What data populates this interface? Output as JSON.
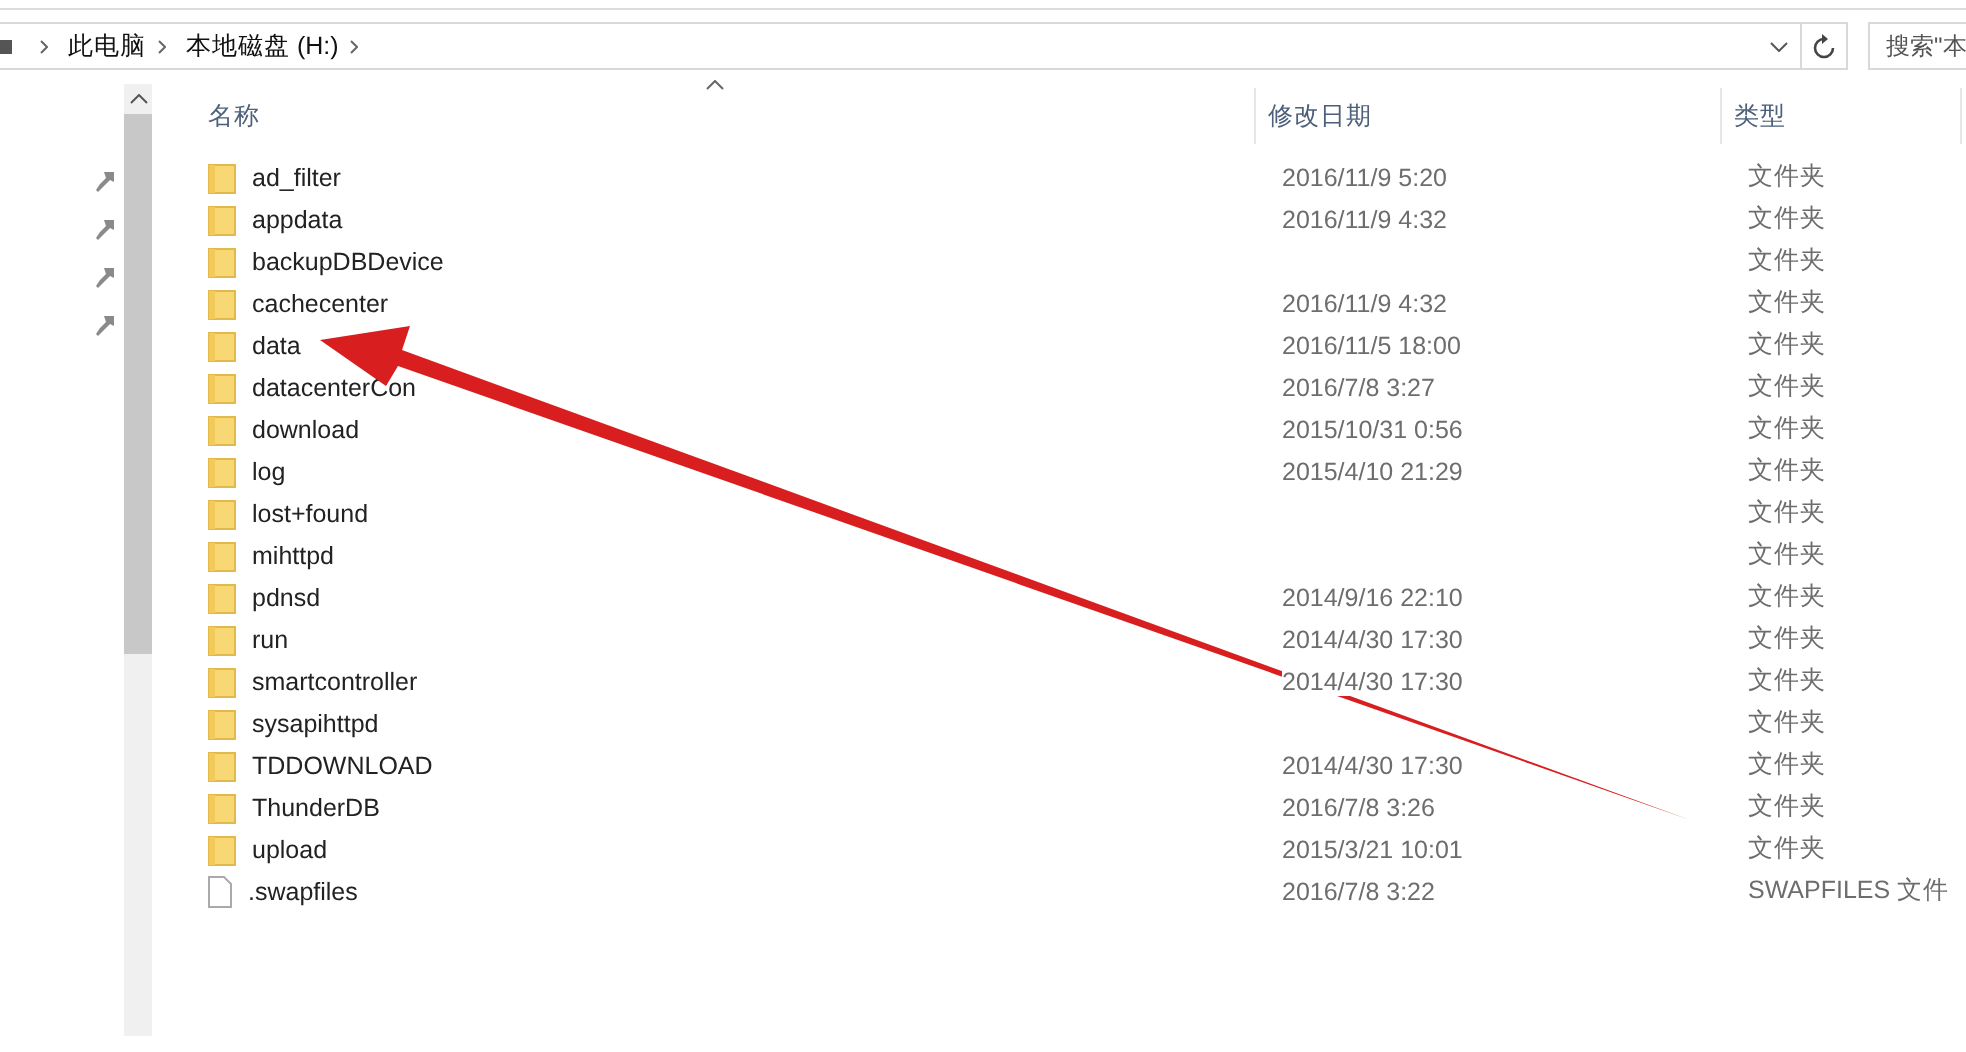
{
  "address_bar": {
    "breadcrumbs": [
      "此电脑",
      "本地磁盘 (H:)"
    ]
  },
  "search": {
    "placeholder": "搜索\"本"
  },
  "columns": [
    "名称",
    "修改日期",
    "类型"
  ],
  "rows": [
    {
      "kind": "folder",
      "name": "ad_filter",
      "date": "2016/11/9 5:20",
      "type": "文件夹"
    },
    {
      "kind": "folder",
      "name": "appdata",
      "date": "2016/11/9 4:32",
      "type": "文件夹"
    },
    {
      "kind": "folder",
      "name": "backupDBDevice",
      "type": "文件夹"
    },
    {
      "kind": "folder",
      "name": "cachecenter",
      "date": "2016/11/9 4:32",
      "type": "文件夹"
    },
    {
      "kind": "folder",
      "name": "data",
      "date": "2016/11/5 18:00",
      "type": "文件夹"
    },
    {
      "kind": "folder",
      "name": "datacenterCon",
      "date": "2016/7/8 3:27",
      "type": "文件夹"
    },
    {
      "kind": "folder",
      "name": "download",
      "date": "2015/10/31 0:56",
      "type": "文件夹"
    },
    {
      "kind": "folder",
      "name": "log",
      "date": "2015/4/10 21:29",
      "type": "文件夹"
    },
    {
      "kind": "folder",
      "name": "lost+found",
      "type": "文件夹"
    },
    {
      "kind": "folder",
      "name": "mihttpd",
      "type": "文件夹"
    },
    {
      "kind": "folder",
      "name": "pdnsd",
      "date": "2014/9/16 22:10",
      "type": "文件夹"
    },
    {
      "kind": "folder",
      "name": "run",
      "date": "2014/4/30 17:30",
      "type": "文件夹"
    },
    {
      "kind": "folder",
      "name": "smartcontroller",
      "date": "2014/4/30 17:30",
      "type": "文件夹"
    },
    {
      "kind": "folder",
      "name": "sysapihttpd",
      "type": "文件夹"
    },
    {
      "kind": "folder",
      "name": "TDDOWNLOAD",
      "date": "2014/4/30 17:30",
      "type": "文件夹"
    },
    {
      "kind": "folder",
      "name": "ThunderDB",
      "date": "2016/7/8 3:26",
      "type": "文件夹"
    },
    {
      "kind": "folder",
      "name": "upload",
      "date": "2015/3/21 10:01",
      "type": "文件夹"
    },
    {
      "kind": "file",
      "name": ".swapfiles",
      "date": "2016/7/8 3:22",
      "type": "SWAPFILES 文件"
    }
  ]
}
